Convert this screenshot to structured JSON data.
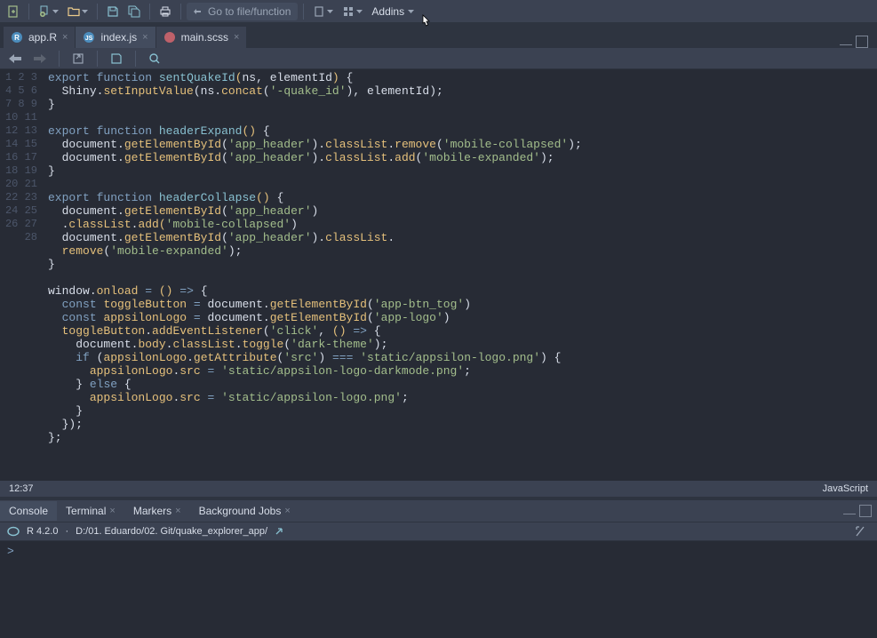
{
  "toolbar": {
    "goto_placeholder": "Go to file/function",
    "addins_label": "Addins"
  },
  "tabs": [
    {
      "label": "app.R",
      "icon": "r-file"
    },
    {
      "label": "index.js",
      "icon": "js-file"
    },
    {
      "label": "main.scss",
      "icon": "scss-file"
    }
  ],
  "active_tab": 1,
  "line_numbers": [
    "1",
    "2",
    "3",
    "4",
    "5",
    "6",
    "7",
    "8",
    "9",
    "10",
    "11",
    "12",
    "13",
    "14",
    "15",
    "16",
    "17",
    "18",
    "19",
    "20",
    "21",
    "22",
    "23",
    "24",
    "25",
    "26",
    "27",
    "28"
  ],
  "status": {
    "position": "12:37",
    "language": "JavaScript"
  },
  "console": {
    "tabs": [
      "Console",
      "Terminal",
      "Markers",
      "Background Jobs"
    ],
    "active_tab": 0,
    "r_version": "R 4.2.0",
    "working_dir": "D:/01. Eduardo/02. Git/quake_explorer_app/",
    "prompt": ">"
  },
  "code": {
    "l1": {
      "export": "export",
      "function": "function",
      "name": "sentQuakeId",
      "params": "ns, elementId"
    },
    "l2": {
      "obj": "Shiny",
      "m1": "setInputValue",
      "p1": "ns",
      "m2": "concat",
      "s1": "'-quake_id'",
      "p2": "elementId"
    },
    "l5": {
      "export": "export",
      "function": "function",
      "name": "headerExpand"
    },
    "l6": {
      "obj": "document",
      "m1": "getElementById",
      "s1": "'app_header'",
      "prop": "classList",
      "m2": "remove",
      "s2": "'mobile-collapsed'"
    },
    "l7": {
      "obj": "document",
      "m1": "getElementById",
      "s1": "'app_header'",
      "prop": "classList",
      "m2": "add",
      "s2": "'mobile-expanded'"
    },
    "l10": {
      "export": "export",
      "function": "function",
      "name": "headerCollapse"
    },
    "l11": {
      "obj": "document",
      "m1": "getElementById",
      "s1": "'app_header'"
    },
    "l12": {
      "prop": "classList",
      "m1": "add",
      "s1": "'mobile-collapsed'"
    },
    "l13": {
      "obj": "document",
      "m1": "getElementById",
      "s1": "'app_header'",
      "prop": "classList"
    },
    "l14": {
      "m1": "remove",
      "s1": "'mobile-expanded'"
    },
    "l17": {
      "obj": "window",
      "prop": "onload"
    },
    "l18": {
      "const": "const",
      "var": "toggleButton",
      "obj": "document",
      "m1": "getElementById",
      "s1": "'app-btn_tog'"
    },
    "l19": {
      "const": "const",
      "var": "appsilonLogo",
      "obj": "document",
      "m1": "getElementById",
      "s1": "'app-logo'"
    },
    "l20": {
      "obj": "toggleButton",
      "m1": "addEventListener",
      "s1": "'click'"
    },
    "l21": {
      "obj": "document",
      "prop1": "body",
      "prop2": "classList",
      "m1": "toggle",
      "s1": "'dark-theme'"
    },
    "l22": {
      "if": "if",
      "obj": "appsilonLogo",
      "m1": "getAttribute",
      "s1": "'src'",
      "s2": "'static/appsilon-logo.png'"
    },
    "l23": {
      "obj": "appsilonLogo",
      "prop": "src",
      "s1": "'static/appsilon-logo-darkmode.png'"
    },
    "l24": {
      "else": "else"
    },
    "l25": {
      "obj": "appsilonLogo",
      "prop": "src",
      "s1": "'static/appsilon-logo.png'"
    }
  }
}
